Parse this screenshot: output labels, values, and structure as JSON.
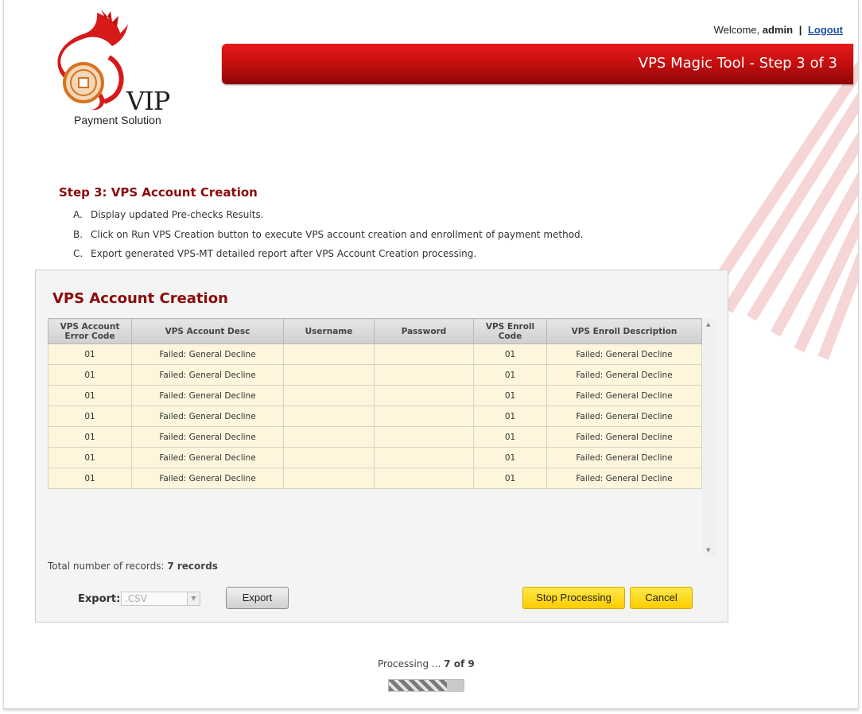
{
  "header": {
    "welcome_prefix": "Welcome,",
    "username": "admin",
    "separator": "|",
    "logout_label": "Logout",
    "title": "VPS Magic Tool - Step 3 of 3"
  },
  "logo": {
    "brand": "VIP",
    "subtitle": "Payment Solution"
  },
  "steps": {
    "title": "Step 3: VPS Account Creation",
    "items": [
      {
        "letter": "A.",
        "text": "Display updated Pre-checks Results."
      },
      {
        "letter": "B.",
        "text": "Click on Run VPS Creation button to execute VPS account creation and enrollment of payment method."
      },
      {
        "letter": "C.",
        "text": "Export generated VPS-MT detailed report after VPS Account Creation processing."
      }
    ]
  },
  "panel": {
    "title": "VPS Account Creation",
    "columns": [
      "VPS Account Error Code",
      "VPS Account Desc",
      "Username",
      "Password",
      "VPS Enroll Code",
      "VPS Enroll Description"
    ],
    "rows": [
      [
        "01",
        "Failed: General Decline",
        "",
        "",
        "01",
        "Failed: General Decline"
      ],
      [
        "01",
        "Failed: General Decline",
        "",
        "",
        "01",
        "Failed: General Decline"
      ],
      [
        "01",
        "Failed: General Decline",
        "",
        "",
        "01",
        "Failed: General Decline"
      ],
      [
        "01",
        "Failed: General Decline",
        "",
        "",
        "01",
        "Failed: General Decline"
      ],
      [
        "01",
        "Failed: General Decline",
        "",
        "",
        "01",
        "Failed: General Decline"
      ],
      [
        "01",
        "Failed: General Decline",
        "",
        "",
        "01",
        "Failed: General Decline"
      ],
      [
        "01",
        "Failed: General Decline",
        "",
        "",
        "01",
        "Failed: General Decline"
      ]
    ],
    "total_label": "Total number of records:",
    "total_value": "7 records",
    "export_label": "Export:",
    "export_format": ".CSV",
    "export_button": "Export",
    "stop_button": "Stop Processing",
    "cancel_button": "Cancel"
  },
  "processing": {
    "label": "Processing ...",
    "status": "7 of 9",
    "progress": 0.78
  },
  "colors": {
    "accent": "#c80f0f",
    "heading": "#8b0b0b",
    "row_bg": "#fdf6dc",
    "button_yellow": "#ffd600"
  }
}
